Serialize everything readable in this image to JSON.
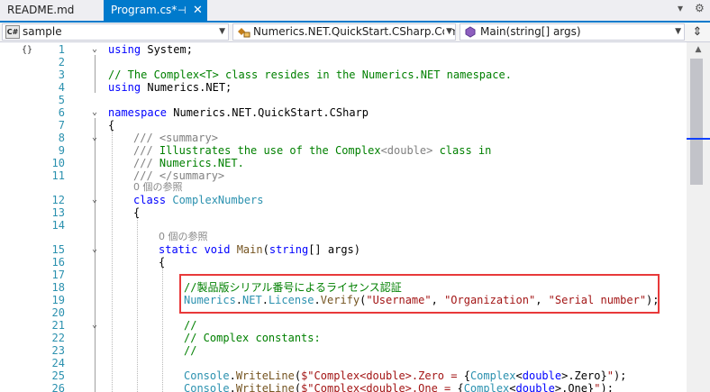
{
  "tabs": [
    {
      "label": "README.md",
      "active": false
    },
    {
      "label": "Program.cs*",
      "active": true,
      "pin": "⊣",
      "close": "✕"
    }
  ],
  "tabbar_icons": {
    "dropdown": "▾",
    "settings": "⚙"
  },
  "nav": {
    "project": {
      "icon_text": "C#",
      "label": "sample"
    },
    "class": {
      "label": "Numerics.NET.QuickStart.CSharp.ComplexNumbers"
    },
    "member": {
      "label": "Main(string[] args)"
    },
    "split_icon": "⇕"
  },
  "code": {
    "l1": {
      "n": "1",
      "using": "using",
      "rest": " System;"
    },
    "l2": {
      "n": "2"
    },
    "l3": {
      "n": "3",
      "comment": "// The Complex<T> class resides in the Numerics.NET namespace."
    },
    "l4": {
      "n": "4",
      "using": "using",
      "rest": " Numerics.NET;"
    },
    "l5": {
      "n": "5"
    },
    "l6": {
      "n": "6",
      "kw": "namespace",
      "rest": " Numerics.NET.QuickStart.CSharp"
    },
    "l7": {
      "n": "7",
      "text": "{"
    },
    "l8": {
      "n": "8",
      "slashes": "///",
      "tag": " <summary>"
    },
    "l9": {
      "n": "9",
      "slashes": "///",
      "c1": " Illustrates the use of the Complex",
      "tag": "<double>",
      "c2": " class in"
    },
    "l10": {
      "n": "10",
      "slashes": "///",
      "c1": " Numerics.NET."
    },
    "l11": {
      "n": "11",
      "slashes": "///",
      "tag": " </summary>"
    },
    "lens1": "0 個の参照",
    "l12": {
      "n": "12",
      "kw": "class",
      "type": " ComplexNumbers"
    },
    "l13": {
      "n": "13",
      "text": "{"
    },
    "l14": {
      "n": "14"
    },
    "lens2": "0 個の参照",
    "l15": {
      "n": "15",
      "kw1": "static",
      "kw2": " void",
      "fn": " Main",
      "p1": "(",
      "kw3": "string",
      "p2": "[] args)"
    },
    "l16": {
      "n": "16",
      "text": "{"
    },
    "l17": {
      "n": "17"
    },
    "l18": {
      "n": "18",
      "comment": "//製品版シリアル番号によるライセンス認証"
    },
    "l19": {
      "n": "19",
      "ns": "Numerics",
      "d1": ".",
      "ns2": "NET",
      "d2": ".",
      "cls": "License",
      "d3": ".",
      "fn": "Verify",
      "p1": "(",
      "s1": "\"Username\"",
      "c1": ", ",
      "s2": "\"Organization\"",
      "c2": ", ",
      "s3": "\"Serial number\"",
      "p2": ");"
    },
    "l20": {
      "n": "20"
    },
    "l21": {
      "n": "21",
      "comment": "//"
    },
    "l22": {
      "n": "22",
      "comment": "// Complex constants:"
    },
    "l23": {
      "n": "23",
      "comment": "//"
    },
    "l24": {
      "n": "24"
    },
    "l25": {
      "n": "25",
      "cls": "Console",
      "d1": ".",
      "fn": "WriteLine",
      "p1": "(",
      "s1": "$\"Complex<double>.Zero = ",
      "b1": "{",
      "cls2": "Complex",
      "t1": "<",
      "kw": "double",
      "t2": ">.Zero",
      "b2": "}",
      "s2": "\"",
      "p2": ");"
    },
    "l26": {
      "n": "26",
      "cls": "Console",
      "d1": ".",
      "fn": "WriteLine",
      "p1": "(",
      "s1": "$\"Complex<double>.One = ",
      "b1": "{",
      "cls2": "Complex",
      "t1": "<",
      "kw": "double",
      "t2": ">.One",
      "b2": "}",
      "s2": "\"",
      "p2": ");"
    }
  }
}
